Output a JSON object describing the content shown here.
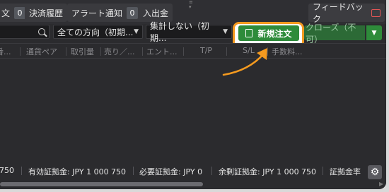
{
  "tabs": {
    "tab1_label": "文",
    "tab1_badge": "0",
    "tab2_label": "決済履歴",
    "tab3_label": "アラート通知",
    "tab3_badge": "0",
    "tab4_label": "入出金",
    "feedback_label": "フィードバック"
  },
  "toolbar": {
    "direction_filter": "全ての方向（初期...",
    "aggregate_filter": "集計しない（初期...",
    "new_order_label": "新規注文",
    "close_label": "クローズ（不可）"
  },
  "columns": [
    "番...",
    "通貨ペア",
    "取引量",
    "売り／...",
    "エント...",
    "T/P",
    "S/L",
    "手数料..."
  ],
  "summary": {
    "partial_value": "750",
    "effective_margin_label": "有効証拠金:",
    "effective_margin_value": "JPY 1 000 750",
    "required_margin_label": "必要証拠金:",
    "required_margin_value": "JPY 0",
    "free_margin_label": "余剰証拠金:",
    "free_margin_value": "JPY 1 000 750",
    "margin_ratio_label": "証拠金率"
  },
  "colors": {
    "accent_green": "#2e8b3a",
    "highlight_orange": "#f59a1f",
    "background": "#2b2b2e"
  },
  "icons": [
    "search-icon",
    "chevron-down-icon",
    "document-icon",
    "feedback-icon",
    "gear-icon",
    "drag-handle-icon"
  ]
}
